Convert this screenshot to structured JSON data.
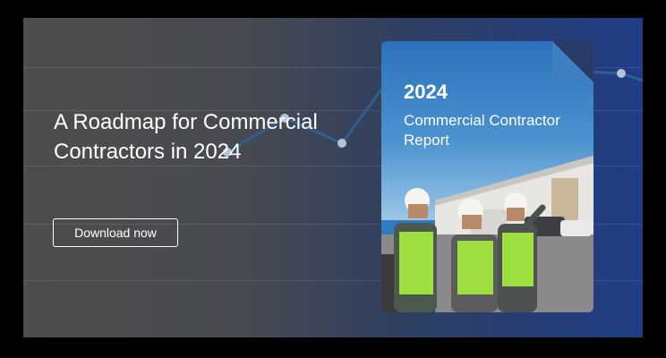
{
  "banner": {
    "headline": "A Roadmap for Commercial Contractors in 2024",
    "cta_label": "Download now"
  },
  "report_cover": {
    "year": "2024",
    "title": "Commercial Contractor Report"
  },
  "colors": {
    "background_left": "#4d4d4d",
    "background_right": "#1f3d86",
    "trend_line": "#2f5f8f",
    "text": "#ffffff"
  },
  "icons": [
    "trend-line-graphic",
    "report-cover-photo"
  ]
}
